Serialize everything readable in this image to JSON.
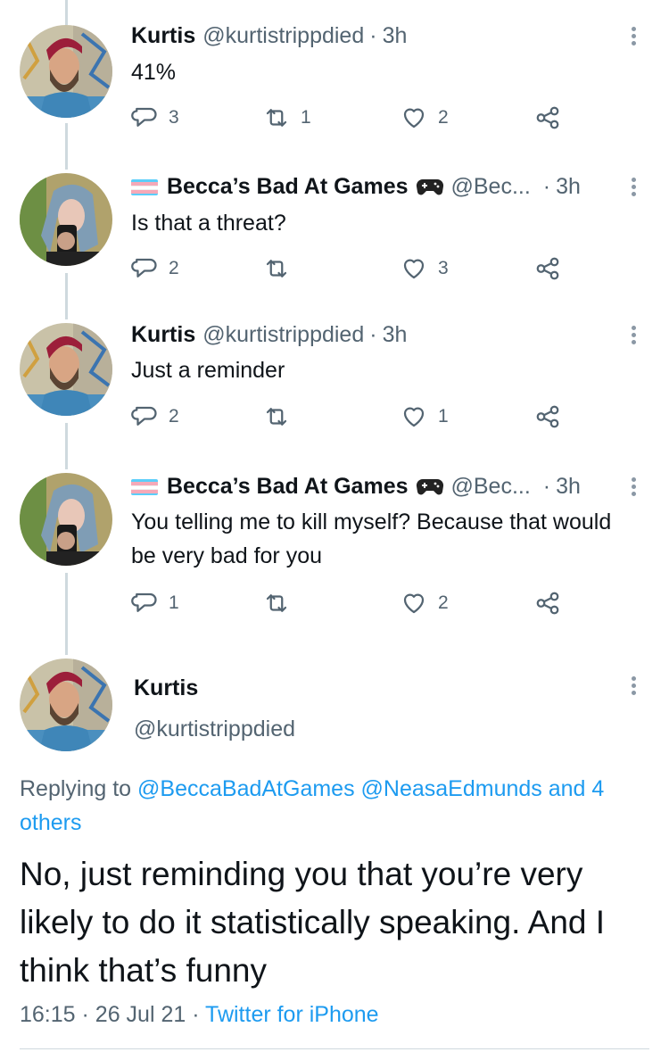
{
  "tweets": [
    {
      "name": "Kurtis",
      "handle": "@kurtistrippdied",
      "sep": "·",
      "time": "3h",
      "text": "41%",
      "replies": "3",
      "retweets": "1",
      "likes": "2",
      "avatar": "kurtis"
    },
    {
      "name": "Becca’s Bad At Games",
      "handle": "@Bec...",
      "sep": "·",
      "time": "3h",
      "text": "Is that a threat?",
      "replies": "2",
      "retweets": "",
      "likes": "3",
      "avatar": "becca"
    },
    {
      "name": "Kurtis",
      "handle": "@kurtistrippdied",
      "sep": "·",
      "time": "3h",
      "text": "Just a reminder",
      "replies": "2",
      "retweets": "",
      "likes": "1",
      "avatar": "kurtis"
    },
    {
      "name": "Becca’s Bad At Games",
      "handle": "@Bec...",
      "sep": "·",
      "time": "3h",
      "text": "You telling me to kill myself? Because that would be very bad for you",
      "replies": "1",
      "retweets": "",
      "likes": "2",
      "avatar": "becca"
    }
  ],
  "main": {
    "name": "Kurtis",
    "handle": "@kurtistrippdied",
    "replying_prefix": "Replying to",
    "replying_user1": "@BeccaBadAtGames",
    "replying_user2": "@NeasaEdmunds",
    "replying_and": "and",
    "replying_others": "4 others",
    "text": "No, just reminding you that you’re very likely to do it statistically speaking. And I think that’s funny",
    "time": "16:15",
    "sep": "·",
    "date": "26 Jul 21",
    "source": "Twitter for iPhone"
  },
  "icons": {
    "reply": "reply-icon",
    "retweet": "retweet-icon",
    "like": "heart-icon",
    "share": "share-icon",
    "more": "more-icon",
    "flag": "trans-flag-icon",
    "controller": "game-controller-icon"
  },
  "colors": {
    "link": "#1d9bf0",
    "secondary": "#536471",
    "thread_line": "#cfd9de",
    "flag_blue": "#5bcefa",
    "flag_pink": "#f5a9b8"
  }
}
